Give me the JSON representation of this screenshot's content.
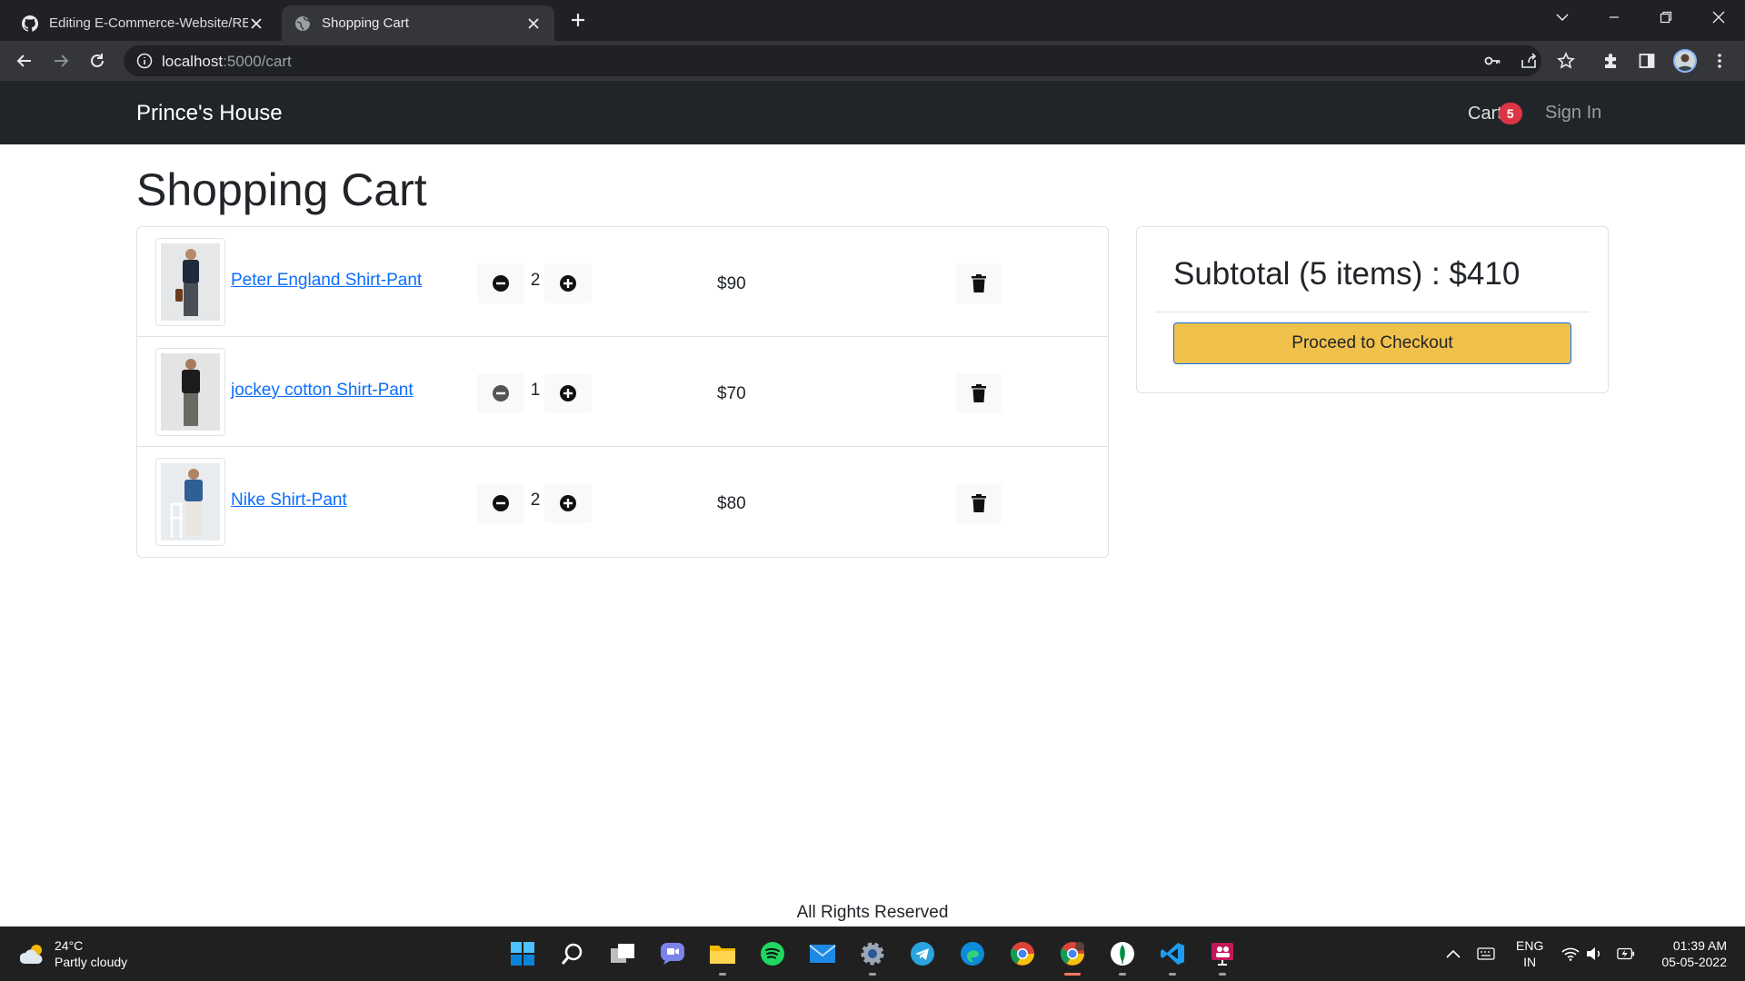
{
  "browser": {
    "tabs": [
      {
        "title": "Editing E-Commerce-Website/RE",
        "active": false
      },
      {
        "title": "Shopping Cart",
        "active": true
      }
    ],
    "url_host": "localhost",
    "url_path": ":5000/cart"
  },
  "navbar": {
    "brand": "Prince's House",
    "cart_label": "Cart",
    "cart_count": "5",
    "signin_label": "Sign In"
  },
  "page": {
    "title": "Shopping Cart"
  },
  "cart_items": [
    {
      "name": "Peter England Shirt-Pant",
      "qty": "2",
      "price": "$90",
      "shirt_color": "#1f2a3a",
      "pant_color": "#4a4f55"
    },
    {
      "name": "jockey cotton Shirt-Pant",
      "qty": "1",
      "price": "$70",
      "shirt_color": "#1c1c1c",
      "pant_color": "#6b6b66"
    },
    {
      "name": "Nike Shirt-Pant",
      "qty": "2",
      "price": "$80",
      "shirt_color": "#2f5f94",
      "pant_color": "#e8e6df"
    }
  ],
  "summary": {
    "subtotal_text": "Subtotal (5 items) : $410",
    "checkout_label": "Proceed to Checkout"
  },
  "footer": {
    "text": "All Rights Reserved"
  },
  "taskbar": {
    "temperature": "24°C",
    "weather": "Partly cloudy",
    "lang_top": "ENG",
    "lang_bottom": "IN",
    "time": "01:39 AM",
    "date": "05-05-2022"
  },
  "colors": {
    "navbar_bg": "#212529",
    "badge_bg": "#dc3545",
    "link": "#0d6efd",
    "checkout_bg": "#f0c14b"
  }
}
